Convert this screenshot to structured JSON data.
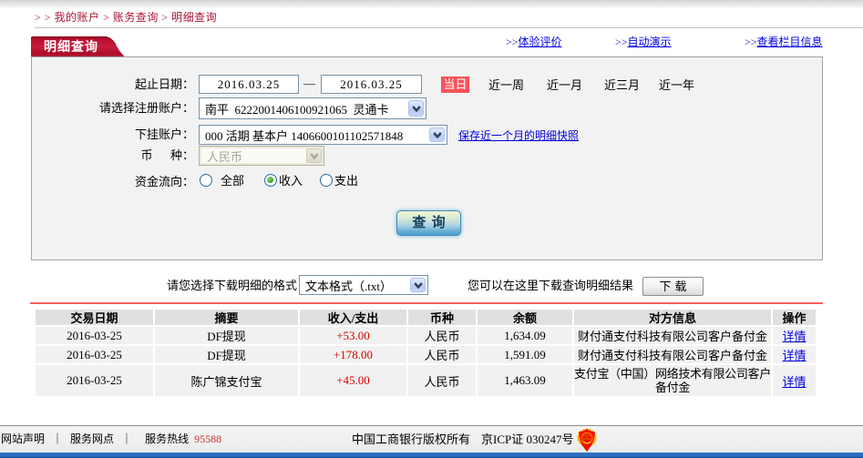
{
  "colors": {
    "brand_red": "#c8102e",
    "breadcrumb_red": "#a81334",
    "link_blue": "#0000dd",
    "amount_red": "#d50000",
    "today_red": "#f8545c",
    "separator_red": "#f4625e",
    "footer_bar_blue": "#2e6fc4"
  },
  "breadcrumb": {
    "prefix": "> > ",
    "separator": " > ",
    "items": [
      "我的账户",
      "账务查询",
      "明细查询"
    ],
    "text": "> > 我的账户 > 账务查询 > 明细查询"
  },
  "tab": {
    "label": "明细查询"
  },
  "top_links": {
    "prefix": ">>",
    "items": [
      "体验评价",
      "自动演示",
      "查看栏目信息"
    ]
  },
  "form": {
    "date_range": {
      "label": "起止日期：",
      "from": "2016.03.25",
      "separator": "—",
      "to": "2016.03.25"
    },
    "quick_ranges": {
      "active": "当日",
      "options": [
        "近一周",
        "近一月",
        "近三月",
        "近一年"
      ]
    },
    "register_account": {
      "label": "请选择注册账户：",
      "value": "南平  6222001406100921065  灵通卡"
    },
    "sub_account": {
      "label": "下挂账户：",
      "value": "000 活期 基本户 1406600101102571848",
      "snapshot_link": "保存近一个月的明细快照"
    },
    "currency": {
      "label": "币　  种：",
      "value": "人民币",
      "disabled": true
    },
    "flow": {
      "label": "资金流向：",
      "options": [
        "全部",
        "收入",
        "支出"
      ],
      "selected": "收入"
    },
    "submit_label": "查 询"
  },
  "download": {
    "format_label": "请您选择下载明细的格式",
    "format_value": "文本格式（.txt）",
    "hint_label": "您可以在这里下载查询明细结果",
    "button_label": "下载"
  },
  "table": {
    "headers": [
      "交易日期",
      "摘要",
      "收入/支出",
      "币种",
      "余额",
      "对方信息",
      "操作"
    ],
    "rows": [
      {
        "date": "2016-03-25",
        "summary": "DF提现",
        "amount": "+53.00",
        "currency": "人民币",
        "balance": "1,634.09",
        "counterparty": "财付通支付科技有限公司客户备付金",
        "action": "详情"
      },
      {
        "date": "2016-03-25",
        "summary": "DF提现",
        "amount": "+178.00",
        "currency": "人民币",
        "balance": "1,591.09",
        "counterparty": "财付通支付科技有限公司客户备付金",
        "action": "详情"
      },
      {
        "date": "2016-03-25",
        "summary": "陈广锦支付宝",
        "amount": "+45.00",
        "currency": "人民币",
        "balance": "1,463.09",
        "counterparty": "支付宝（中国）网络技术有限公司客户备付金",
        "action": "详情"
      }
    ]
  },
  "footer": {
    "link_statement": "网站声明",
    "link_branches": "服务网点",
    "separator": "｜",
    "hotline_label": "服务热线",
    "hotline_number": "95588",
    "copyright": "中国工商银行版权所有",
    "icp": "京ICP证 030247号"
  }
}
